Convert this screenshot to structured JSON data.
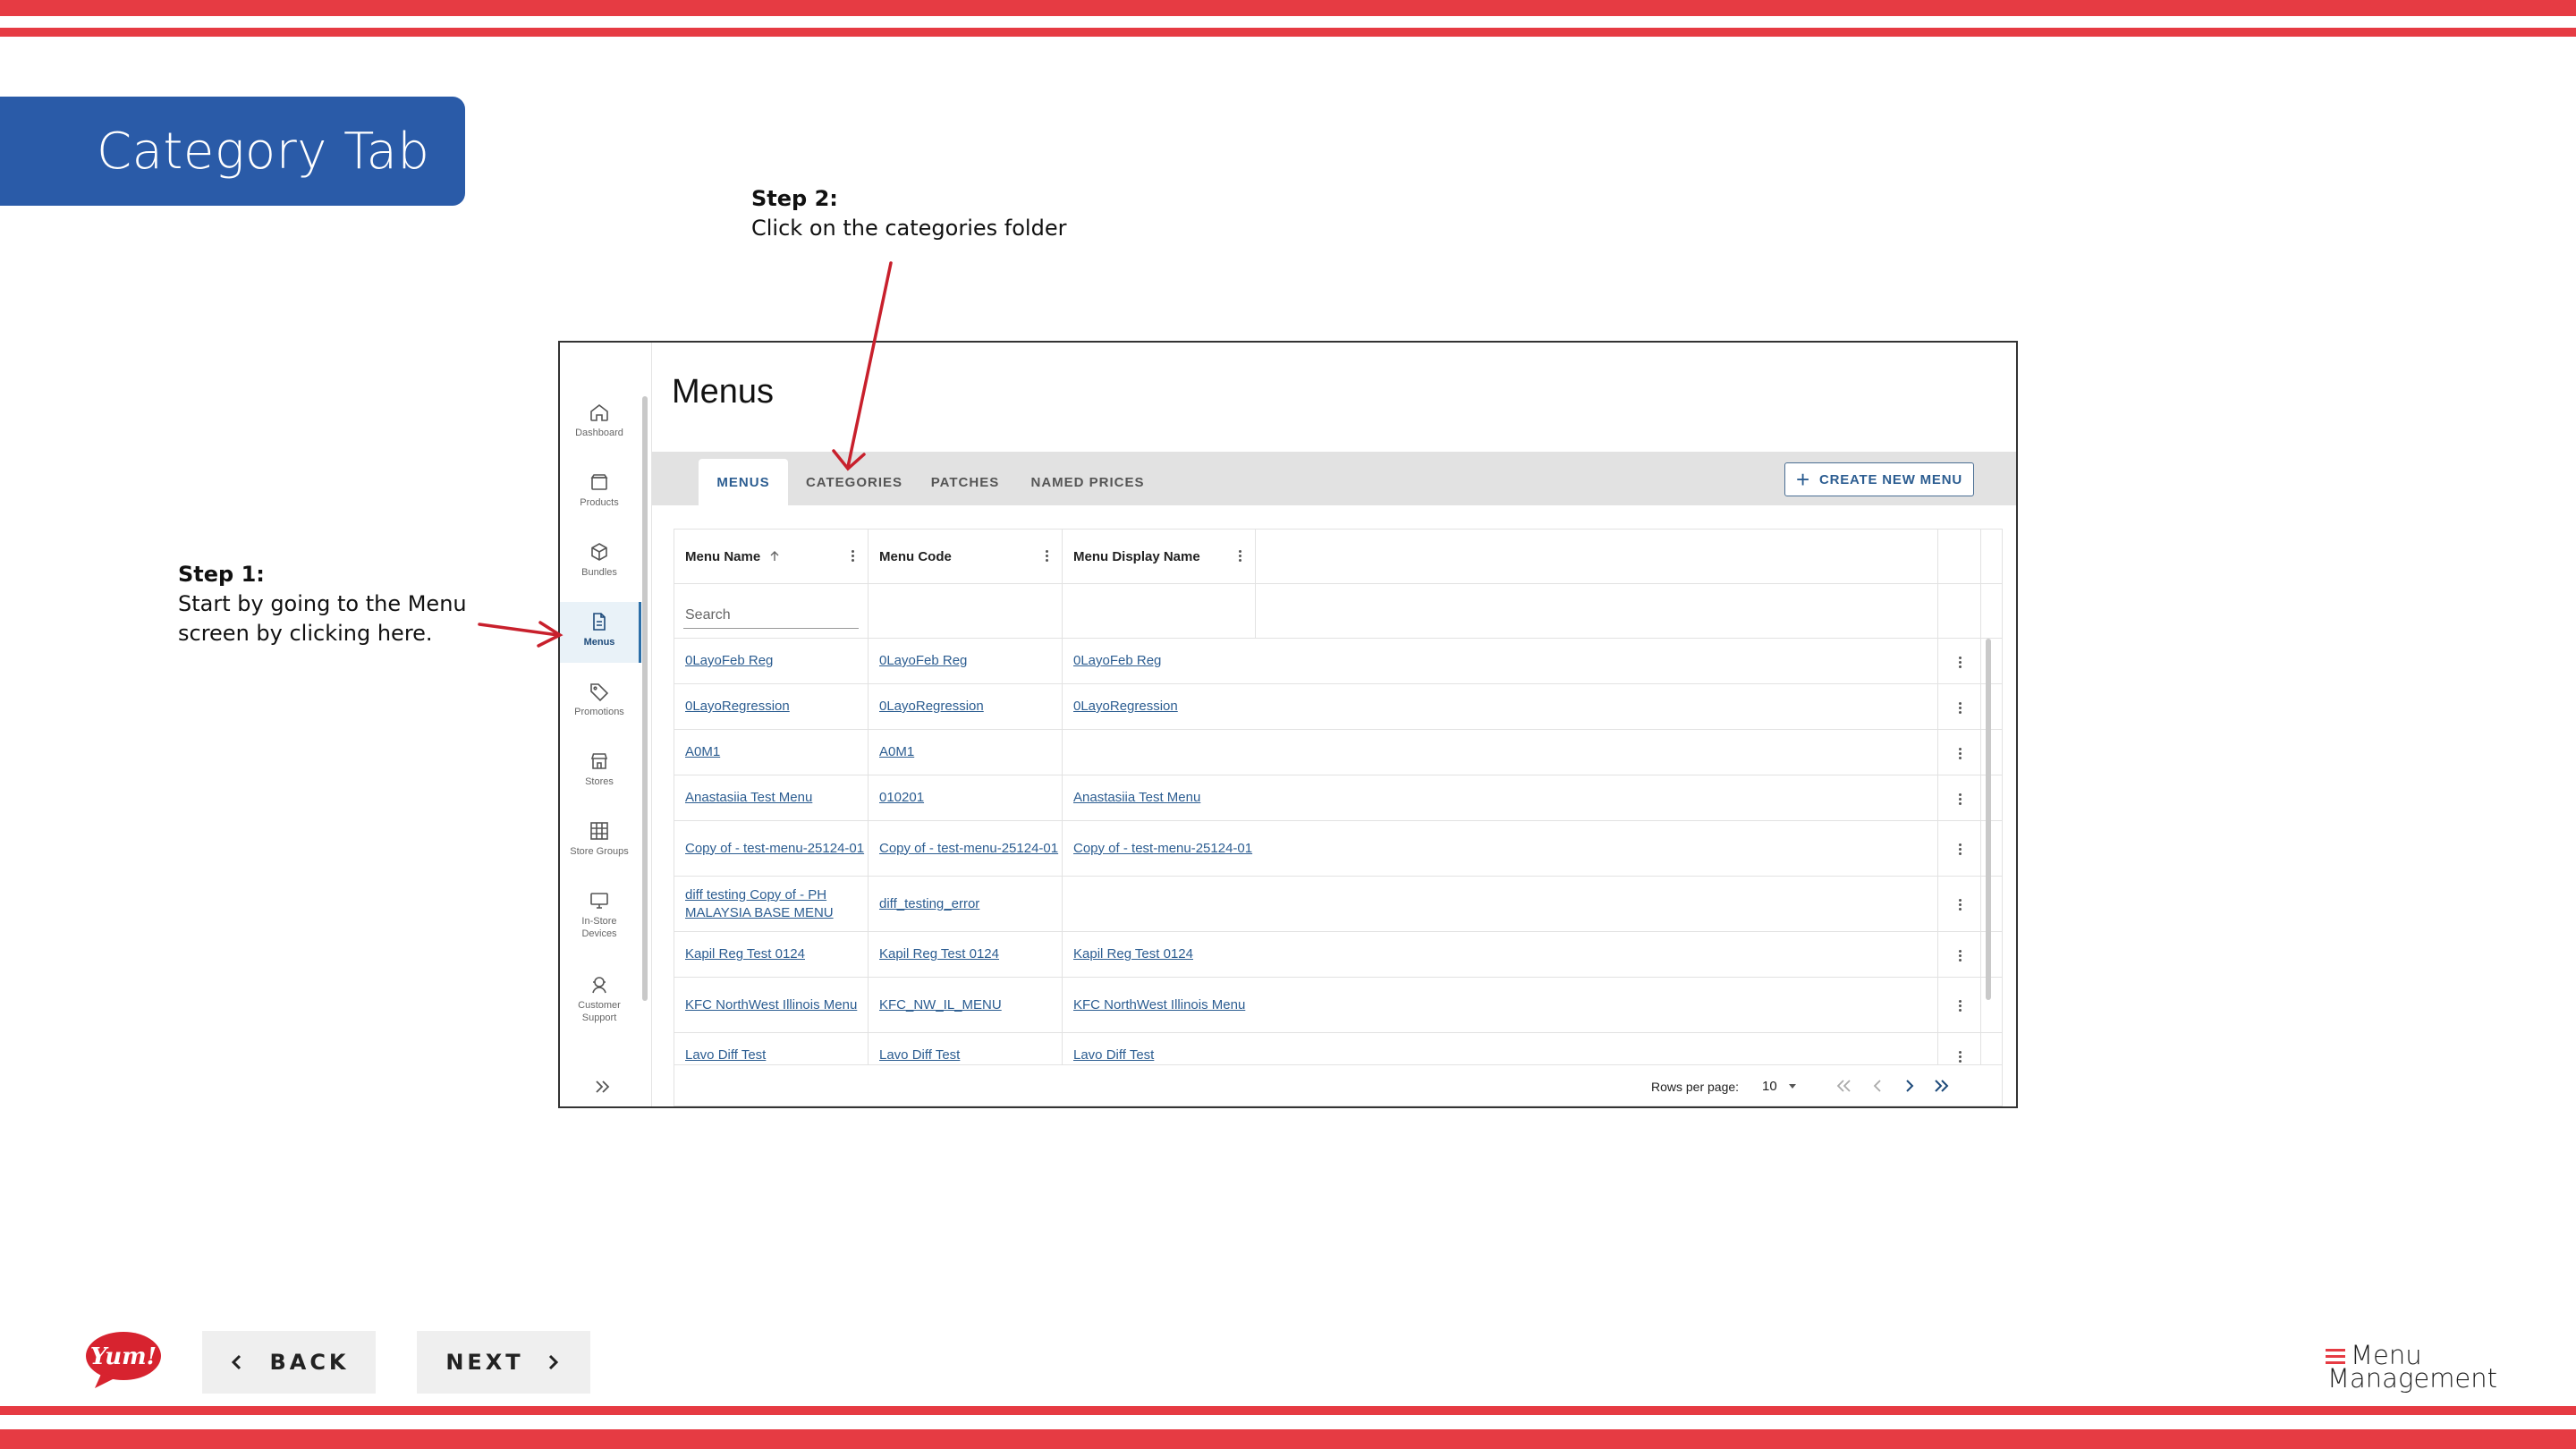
{
  "slide": {
    "title": "Category Tab",
    "step1": {
      "head": "Step 1:",
      "line1": "Start by going to the Menu",
      "line2": "screen by clicking here."
    },
    "step2": {
      "head": "Step 2:",
      "line1": "Click on the categories folder"
    },
    "back_label": "BACK",
    "next_label": "NEXT",
    "brand_logo": "Yum!",
    "product_logo": {
      "line1": "Menu",
      "line2": "Management"
    },
    "colors": {
      "stripe": "#e63b43",
      "title_bg": "#2a5ba8",
      "arrow": "#c8202c"
    }
  },
  "app": {
    "sidebar": {
      "items": [
        {
          "label": "Dashboard",
          "icon": "home-icon"
        },
        {
          "label": "Products",
          "icon": "box-icon"
        },
        {
          "label": "Bundles",
          "icon": "cube-icon"
        },
        {
          "label": "Menus",
          "icon": "document-icon",
          "active": true
        },
        {
          "label": "Promotions",
          "icon": "tag-icon"
        },
        {
          "label": "Stores",
          "icon": "storefront-icon"
        },
        {
          "label": "Store Groups",
          "icon": "grid-icon"
        },
        {
          "label": "In-Store Devices",
          "icon": "monitor-icon"
        },
        {
          "label": "Customer Support",
          "icon": "support-icon"
        }
      ]
    },
    "page_title": "Menus",
    "tabs": [
      {
        "label": "MENUS",
        "active": true
      },
      {
        "label": "CATEGORIES"
      },
      {
        "label": "PATCHES"
      },
      {
        "label": "NAMED PRICES"
      }
    ],
    "create_button": "CREATE NEW MENU",
    "table": {
      "columns": [
        "Menu Name",
        "Menu Code",
        "Menu Display Name"
      ],
      "search_placeholder": "Search",
      "rows": [
        [
          "0LayoFeb Reg",
          "0LayoFeb Reg",
          "0LayoFeb Reg"
        ],
        [
          "0LayoRegression",
          "0LayoRegression",
          "0LayoRegression"
        ],
        [
          "A0M1",
          "A0M1",
          ""
        ],
        [
          "Anastasiia Test Menu",
          "010201",
          "Anastasiia Test Menu"
        ],
        [
          "Copy of - test-menu-25124-01",
          "Copy of - test-menu-25124-01",
          "Copy of - test-menu-25124-01"
        ],
        [
          "diff testing Copy of - PH MALAYSIA BASE MENU",
          "diff_testing_error",
          ""
        ],
        [
          "Kapil Reg Test 0124",
          "Kapil Reg Test 0124",
          "Kapil Reg Test 0124"
        ],
        [
          "KFC NorthWest Illinois Menu",
          "KFC_NW_IL_MENU",
          "KFC NorthWest Illinois Menu"
        ],
        [
          "Lavo Diff Test",
          "Lavo Diff Test",
          "Lavo Diff Test"
        ]
      ]
    },
    "pagination": {
      "rows_per_page_label": "Rows per page:",
      "rows_per_page": "10"
    }
  }
}
